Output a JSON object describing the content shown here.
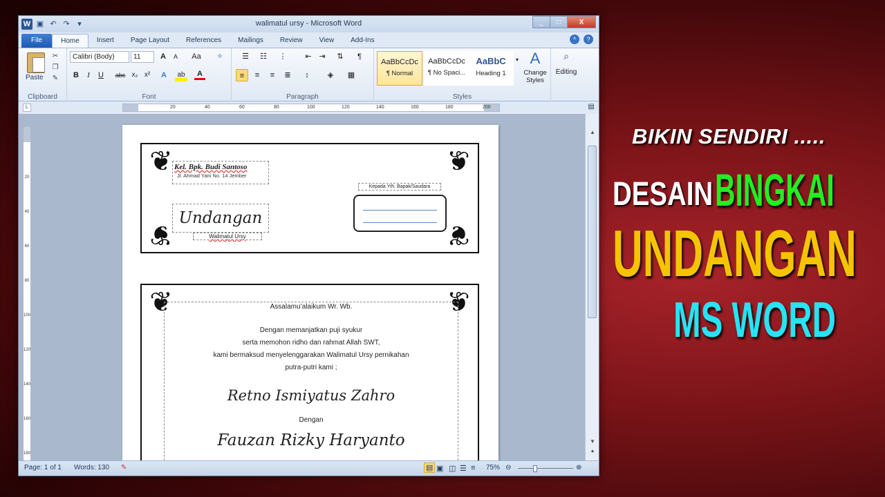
{
  "window": {
    "title": "walimatul ursy  -  Microsoft Word",
    "qat_icons": [
      "word-logo-icon",
      "save-icon",
      "undo-icon",
      "redo-icon",
      "customize-icon"
    ],
    "controls": [
      "_",
      "□",
      "X"
    ]
  },
  "tabs": [
    {
      "label": "File"
    },
    {
      "label": "Home"
    },
    {
      "label": "Insert"
    },
    {
      "label": "Page Layout"
    },
    {
      "label": "References"
    },
    {
      "label": "Mailings"
    },
    {
      "label": "Review"
    },
    {
      "label": "View"
    },
    {
      "label": "Add-Ins"
    }
  ],
  "ribbon": {
    "clipboard": {
      "paste": "Paste",
      "label": "Clipboard"
    },
    "font": {
      "name": "Calibri (Body)",
      "size": "11",
      "label": "Font",
      "grow": "A",
      "shrink": "A",
      "case": "Aa",
      "bold": "B",
      "italic": "I",
      "underline": "U",
      "strike": "abc",
      "sub": "x₂",
      "sup": "x²",
      "effects": "A",
      "highlight": "ab",
      "color": "A"
    },
    "paragraph": {
      "label": "Paragraph",
      "pilcrow": "¶"
    },
    "styles": {
      "label": "Styles",
      "items": [
        {
          "sample": "AaBbCcDc",
          "name": "¶ Normal"
        },
        {
          "sample": "AaBbCcDc",
          "name": "¶ No Spaci..."
        },
        {
          "sample": "AaBbC",
          "name": "Heading 1"
        }
      ],
      "change": "Change Styles"
    },
    "editing": {
      "label": "Editing"
    }
  },
  "ruler": {
    "h_ticks": [
      "20",
      "40",
      "60",
      "80",
      "100",
      "120",
      "140",
      "160",
      "180",
      "200"
    ],
    "v_ticks": [
      "20",
      "40",
      "60",
      "80",
      "100",
      "120",
      "140",
      "160",
      "180"
    ]
  },
  "document": {
    "sender_name": "Kel. Bpk. Budi Santoso",
    "sender_address": "Jl. Ahmad Yani No. 14 Jember",
    "recipient_label": "Kepada Yth. Bapak/Saudara",
    "title": "Undangan",
    "subtitle": "Walimatul Ursy",
    "greeting": "Assalamu’alaikum Wr. Wb.",
    "body": [
      "Dengan memanjatkan puji  syukur",
      "serta memohon ridho dan rahmat Allah SWT,",
      "kami bermaksud menyelenggarakan Walimatul Ursy pernikahan",
      "putra-putri kami ;"
    ],
    "bride": "Retno Ismiyatus Zahro",
    "conj": "Dengan",
    "groom": "Fauzan Rizky Haryanto"
  },
  "status": {
    "page": "Page: 1 of 1",
    "words": "Words: 130",
    "zoom": "75%"
  },
  "overlay": {
    "line1": "BIKIN SENDIRI .....",
    "line2a": "DESAIN",
    "line2b": "BINGKAI",
    "line3": "UNDANGAN",
    "line4": "MS WORD",
    "colors": {
      "white": "#ffffff",
      "green": "#22ee22",
      "yellow": "#f5c400",
      "cyan": "#27e3f5"
    }
  }
}
